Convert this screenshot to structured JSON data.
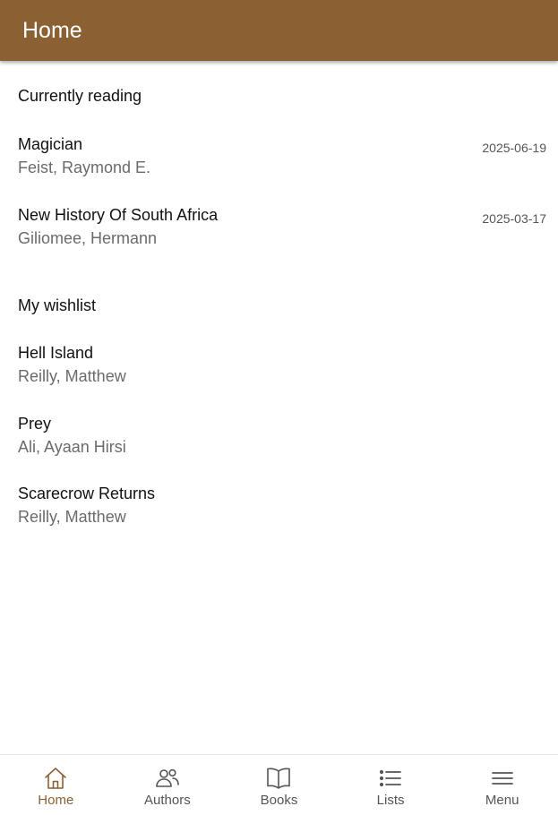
{
  "header": {
    "title": "Home"
  },
  "currently_reading": {
    "title": "Currently reading",
    "books": [
      {
        "title": "Magician",
        "author": "Feist, Raymond E.",
        "date": "2025-06-19"
      },
      {
        "title": "New History Of South Africa",
        "author": "Giliomee, Hermann",
        "date": "2025-03-17"
      }
    ]
  },
  "wishlist": {
    "title": "My wishlist",
    "books": [
      {
        "title": "Hell Island",
        "author": "Reilly, Matthew"
      },
      {
        "title": "Prey",
        "author": "Ali, Ayaan Hirsi"
      },
      {
        "title": "Scarecrow Returns",
        "author": "Reilly, Matthew"
      }
    ]
  },
  "bottom_nav": {
    "items": [
      {
        "label": "Home",
        "icon": "home-icon",
        "active": true
      },
      {
        "label": "Authors",
        "icon": "people-icon",
        "active": false
      },
      {
        "label": "Books",
        "icon": "open-book-icon",
        "active": false
      },
      {
        "label": "Lists",
        "icon": "list-icon",
        "active": false
      },
      {
        "label": "Menu",
        "icon": "hamburger-menu-icon",
        "active": false
      }
    ]
  },
  "colors": {
    "brand": "#8b6133",
    "active_nav": "#8b6133",
    "inactive_nav": "#555555"
  }
}
